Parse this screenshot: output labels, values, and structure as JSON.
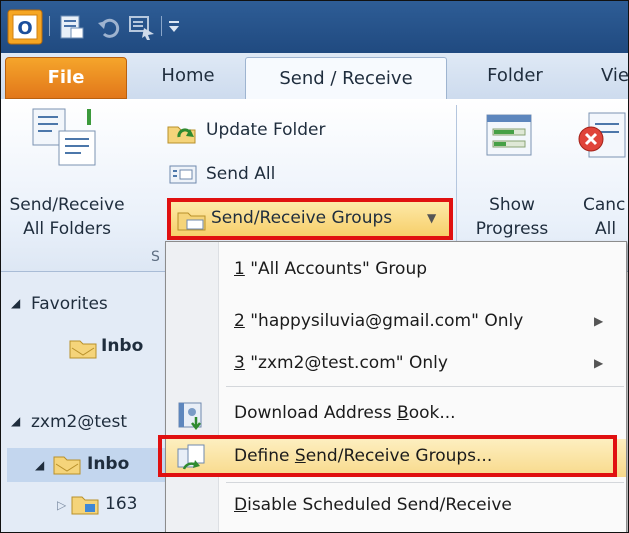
{
  "tabs": {
    "file": "File",
    "home": "Home",
    "send_receive": "Send / Receive",
    "folder": "Folder",
    "view": "Vie"
  },
  "ribbon": {
    "send_receive_all_line1": "Send/Receive",
    "send_receive_all_line2": "All Folders",
    "update_folder": "Update Folder",
    "send_all": "Send All",
    "send_receive_groups": "Send/Receive Groups",
    "group_label_partial": "S",
    "show_progress_line1": "Show",
    "show_progress_line2": "Progress",
    "cancel_all_line1": "Canc",
    "cancel_all_line2": "All"
  },
  "nav": {
    "favorites": "Favorites",
    "inbox_favorite": "Inbo",
    "account": "zxm2@test",
    "inbox": "Inbo",
    "subfolder": "163"
  },
  "menu": {
    "item1_num": "1",
    "item1_text": " \"All Accounts\" Group",
    "item2_num": "2",
    "item2_text": " \"happysiluvia@gmail.com\" Only",
    "item3_num": "3",
    "item3_text": " \"zxm2@test.com\" Only",
    "download_pre": "Download Address ",
    "download_key": "B",
    "download_post": "ook...",
    "define_pre": "Define ",
    "define_key": "S",
    "define_post": "end/Receive Groups...",
    "disable_key": "D",
    "disable_post": "isable Scheduled Send/Receive"
  },
  "icons": {
    "app": "outlook-app-icon",
    "dropdown": "chevron-down-icon",
    "submenu": "chevron-right-icon"
  },
  "colors": {
    "highlight_border": "#e01010",
    "file_tab": "#e2771a",
    "title_bar": "#204a80"
  }
}
